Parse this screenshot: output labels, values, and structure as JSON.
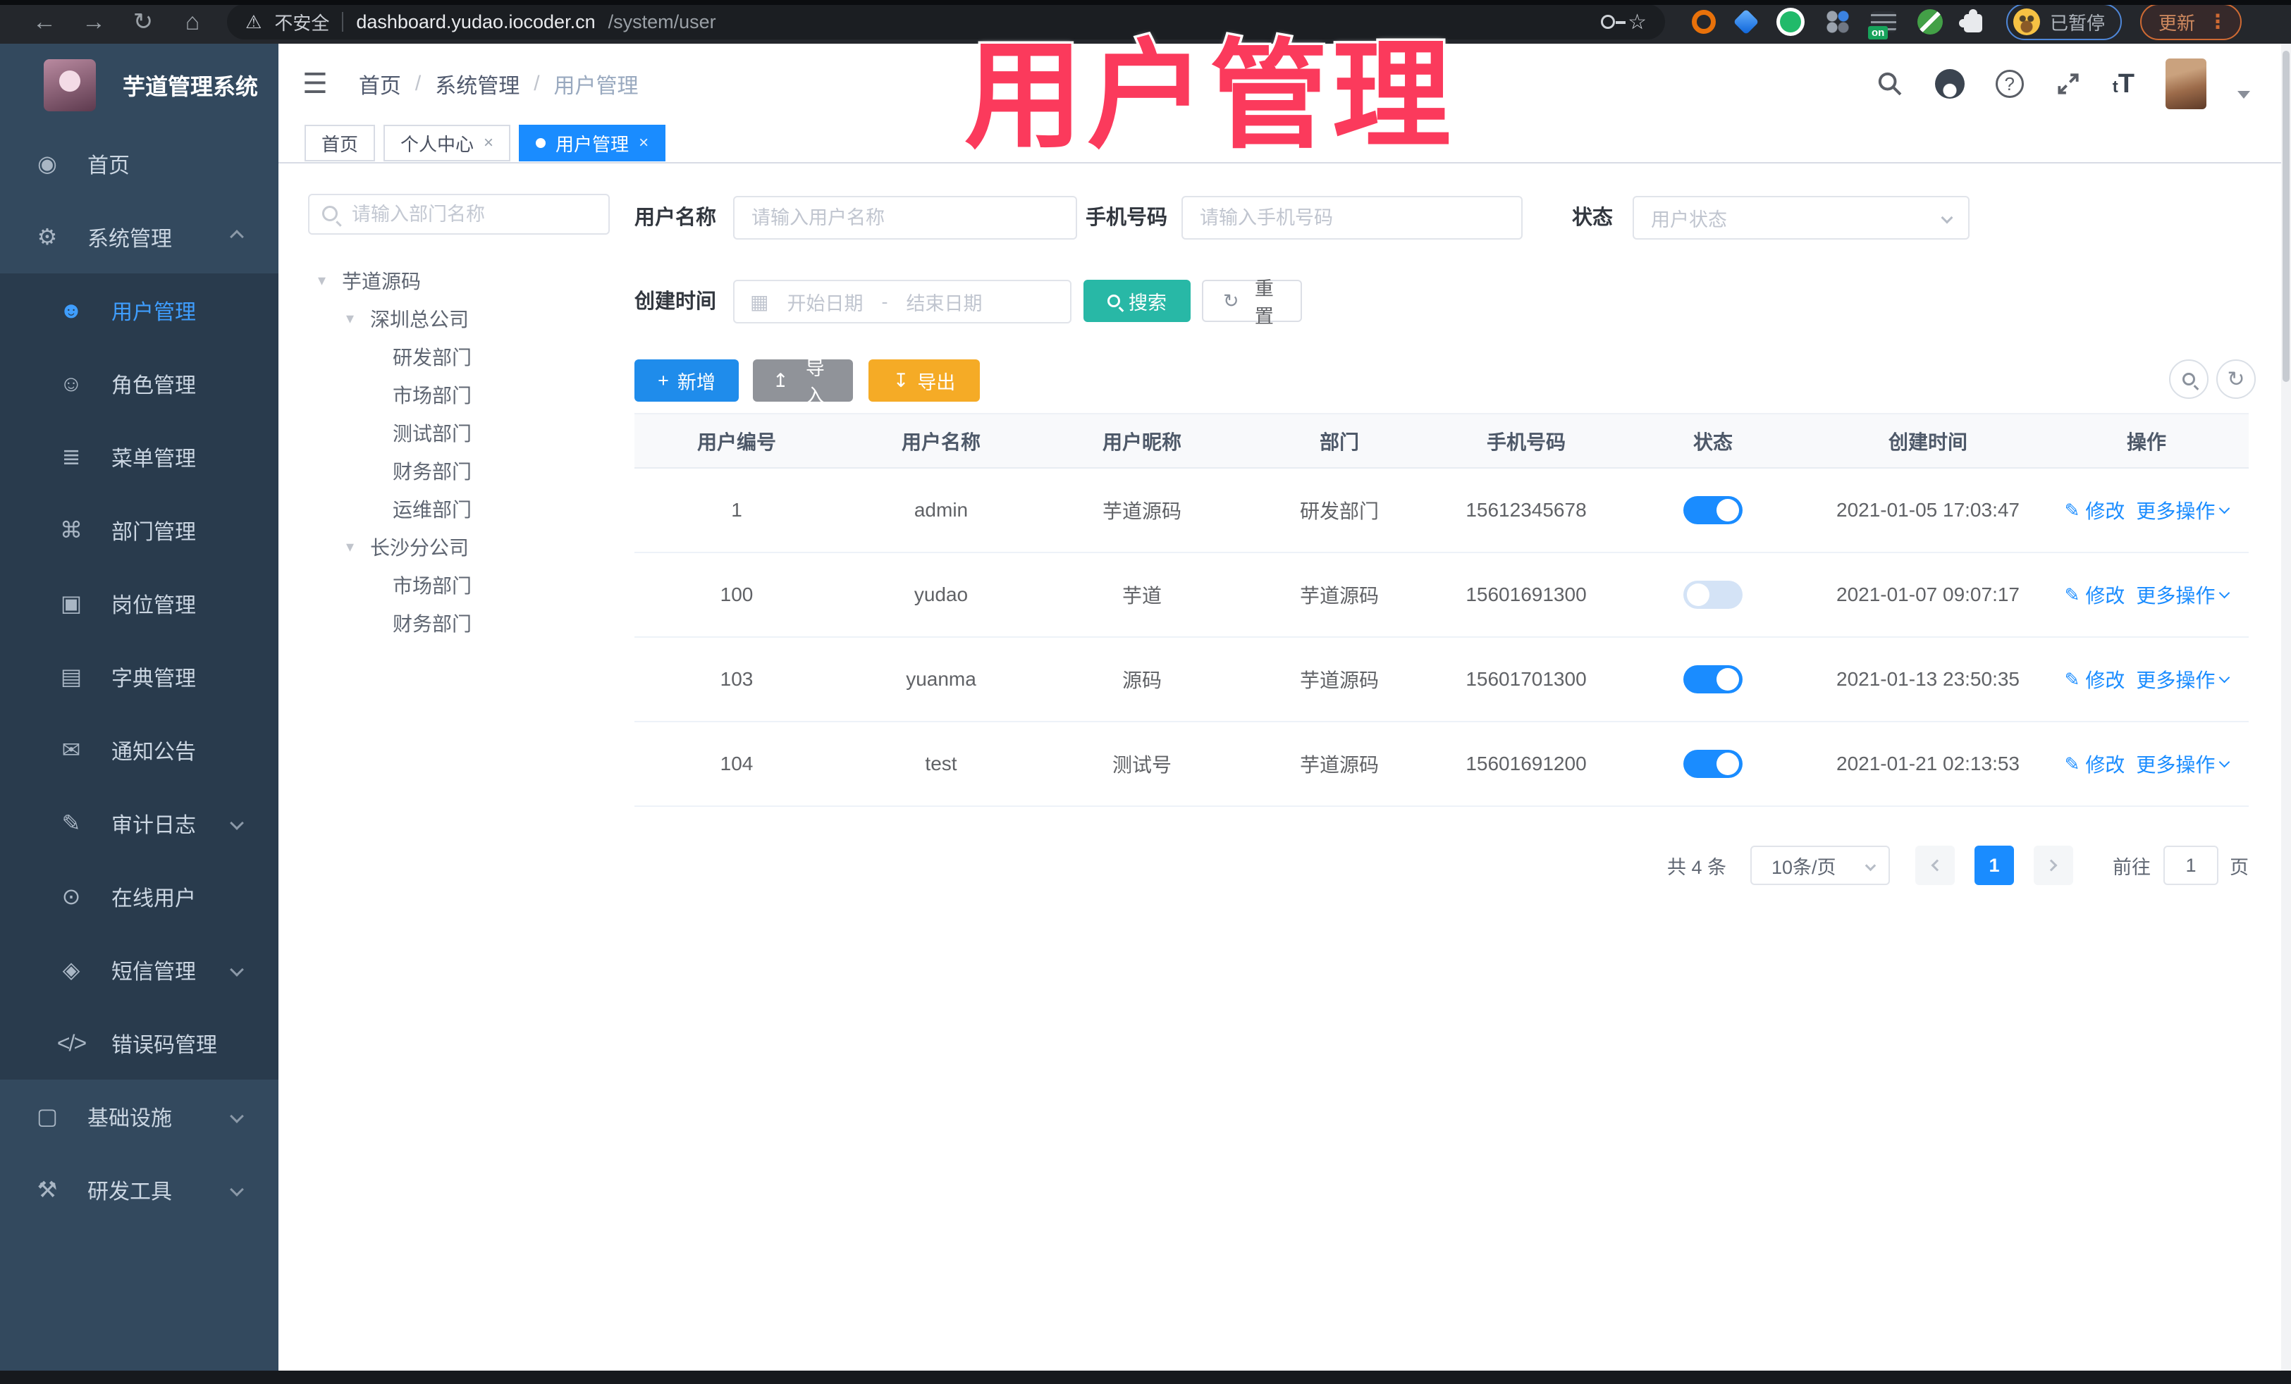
{
  "browser": {
    "security": "不安全",
    "url_host": "dashboard.yudao.iocoder.cn",
    "url_path": "/system/user",
    "ext_on_badge": "on",
    "paused": "已暂停",
    "update": "更新"
  },
  "overlay": {
    "title": "用户管理"
  },
  "sidebar": {
    "logo_title": "芋道管理系统",
    "home": "首页",
    "system": "系统管理",
    "submenu": [
      {
        "label": "用户管理"
      },
      {
        "label": "角色管理"
      },
      {
        "label": "菜单管理"
      },
      {
        "label": "部门管理"
      },
      {
        "label": "岗位管理"
      },
      {
        "label": "字典管理"
      },
      {
        "label": "通知公告"
      },
      {
        "label": "审计日志"
      },
      {
        "label": "在线用户"
      },
      {
        "label": "短信管理"
      },
      {
        "label": "错误码管理"
      }
    ],
    "infra": "基础设施",
    "tools": "研发工具"
  },
  "topbar": {
    "breadcrumb": [
      "首页",
      "系统管理",
      "用户管理"
    ]
  },
  "tabs": [
    {
      "label": "首页"
    },
    {
      "label": "个人中心"
    },
    {
      "label": "用户管理"
    }
  ],
  "tree": {
    "search_placeholder": "请输入部门名称",
    "nodes": [
      {
        "label": "芋道源码"
      },
      {
        "label": "深圳总公司"
      },
      {
        "label": "研发部门"
      },
      {
        "label": "市场部门"
      },
      {
        "label": "测试部门"
      },
      {
        "label": "财务部门"
      },
      {
        "label": "运维部门"
      },
      {
        "label": "长沙分公司"
      },
      {
        "label": "市场部门"
      },
      {
        "label": "财务部门"
      }
    ]
  },
  "filters": {
    "username_label": "用户名称",
    "username_placeholder": "请输入用户名称",
    "mobile_label": "手机号码",
    "mobile_placeholder": "请输入手机号码",
    "status_label": "状态",
    "status_placeholder": "用户状态",
    "createtime_label": "创建时间",
    "date_start": "开始日期",
    "date_sep": "-",
    "date_end": "结束日期",
    "search": "搜索",
    "reset": "重置"
  },
  "toolbar": {
    "add": "新增",
    "import": "导入",
    "export": "导出"
  },
  "table": {
    "columns": [
      "用户编号",
      "用户名称",
      "用户昵称",
      "部门",
      "手机号码",
      "状态",
      "创建时间",
      "操作"
    ],
    "edit": "修改",
    "more": "更多操作",
    "rows": [
      {
        "id": "1",
        "username": "admin",
        "nickname": "芋道源码",
        "dept": "研发部门",
        "mobile": "15612345678",
        "status": true,
        "created": "2021-01-05 17:03:47"
      },
      {
        "id": "100",
        "username": "yudao",
        "nickname": "芋道",
        "dept": "芋道源码",
        "mobile": "15601691300",
        "status": false,
        "created": "2021-01-07 09:07:17"
      },
      {
        "id": "103",
        "username": "yuanma",
        "nickname": "源码",
        "dept": "芋道源码",
        "mobile": "15601701300",
        "status": true,
        "created": "2021-01-13 23:50:35"
      },
      {
        "id": "104",
        "username": "test",
        "nickname": "测试号",
        "dept": "芋道源码",
        "mobile": "15601691200",
        "status": true,
        "created": "2021-01-21 02:13:53"
      }
    ]
  },
  "pagination": {
    "total": "共 4 条",
    "page_size": "10条/页",
    "page": "1",
    "goto": "前往",
    "goto_value": "1",
    "unit": "页"
  },
  "colors": {
    "accent": "#1a8cff",
    "search_button_teal": "#28b8a6",
    "export_button_orange": "#f5ab26",
    "annotation_pink": "#fb3a5c",
    "sidebar_bg": "#33495e",
    "sidebar_submenu_bg": "#293b4d"
  }
}
